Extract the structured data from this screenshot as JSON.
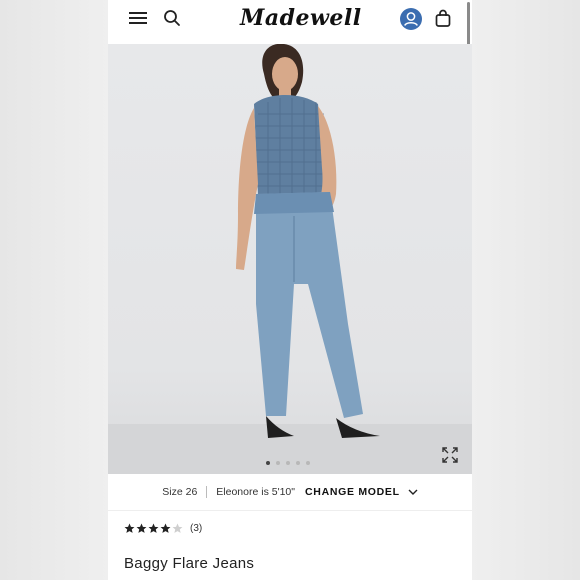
{
  "brand": {
    "logo_text": "Madewell"
  },
  "header": {
    "icons": [
      "menu-icon",
      "search-icon",
      "account-icon",
      "bag-icon"
    ],
    "account_color": "#3b6db0"
  },
  "gallery": {
    "slide_count": 5,
    "active_slide": 1
  },
  "model_info": {
    "size": "Size 26",
    "model_height": "Eleonore is 5'10\"",
    "change_label": "CHANGE MODEL"
  },
  "product": {
    "rating": 4,
    "rating_max": 5,
    "review_count": "(3)",
    "title": "Baggy Flare Jeans"
  }
}
